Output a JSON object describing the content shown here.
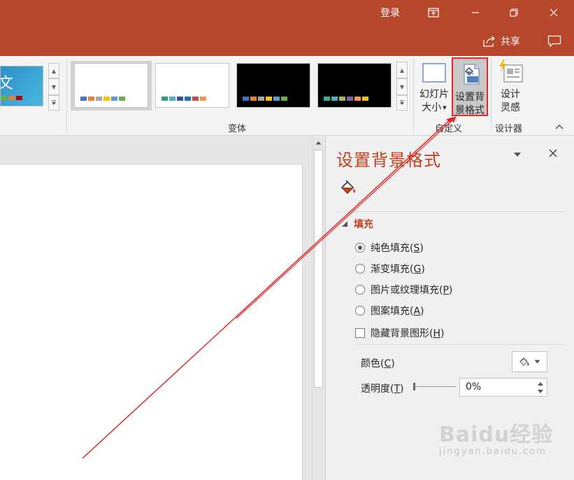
{
  "titlebar": {
    "signin_label": "登录",
    "share_label": "共享",
    "bg_color": "#b7472a"
  },
  "ribbon": {
    "variant_group_label": "变体",
    "customize_group_label": "自定义",
    "designer_group_label": "设计器",
    "theme_thumb_text": "文",
    "slide_size_label_1": "幻灯片",
    "slide_size_label_2": "大小",
    "format_bg_label_1": "设置背",
    "format_bg_label_2": "景格式",
    "design_ideas_label_1": "设计",
    "design_ideas_label_2": "灵感",
    "variants": [
      {
        "dark": false,
        "swatches": [
          "#4472c4",
          "#ed7d31",
          "#a5a5a5",
          "#ffc000",
          "#5b9bd5",
          "#70ad47"
        ]
      },
      {
        "dark": false,
        "swatches": [
          "#2e9e7a",
          "#4bacc6",
          "#2f5597",
          "#1f6fb6",
          "#c0504d",
          "#f79646"
        ]
      },
      {
        "dark": true,
        "swatches": [
          "#4472c4",
          "#ed7d31",
          "#a5a5a5",
          "#ffc000",
          "#5b9bd5",
          "#70ad47"
        ]
      },
      {
        "dark": true,
        "swatches": [
          "#2eb398",
          "#4bacc6",
          "#9bbb59",
          "#8064a2",
          "#f79646",
          "#f2c314"
        ]
      }
    ]
  },
  "pane": {
    "title": "设置背景格式",
    "fill_section": "填充",
    "options": [
      {
        "label": "纯色填充",
        "key": "S",
        "selected": true
      },
      {
        "label": "渐变填充",
        "key": "G",
        "selected": false
      },
      {
        "label": "图片或纹理填充",
        "key": "P",
        "selected": false
      },
      {
        "label": "图案填充",
        "key": "A",
        "selected": false
      }
    ],
    "hide_bg_label": "隐藏背景图形",
    "hide_bg_key": "H",
    "color_label": "颜色",
    "color_key": "C",
    "transparency_label": "透明度",
    "transparency_key": "T",
    "transparency_value": "0%",
    "transparency_fraction": 0
  },
  "watermark": {
    "brand": "Baidu经验",
    "url": "jingyan.baidu.com"
  },
  "colors": {
    "accent": "#c43e1c",
    "highlight_box": "#e8262c",
    "arrow": "#e02020"
  }
}
